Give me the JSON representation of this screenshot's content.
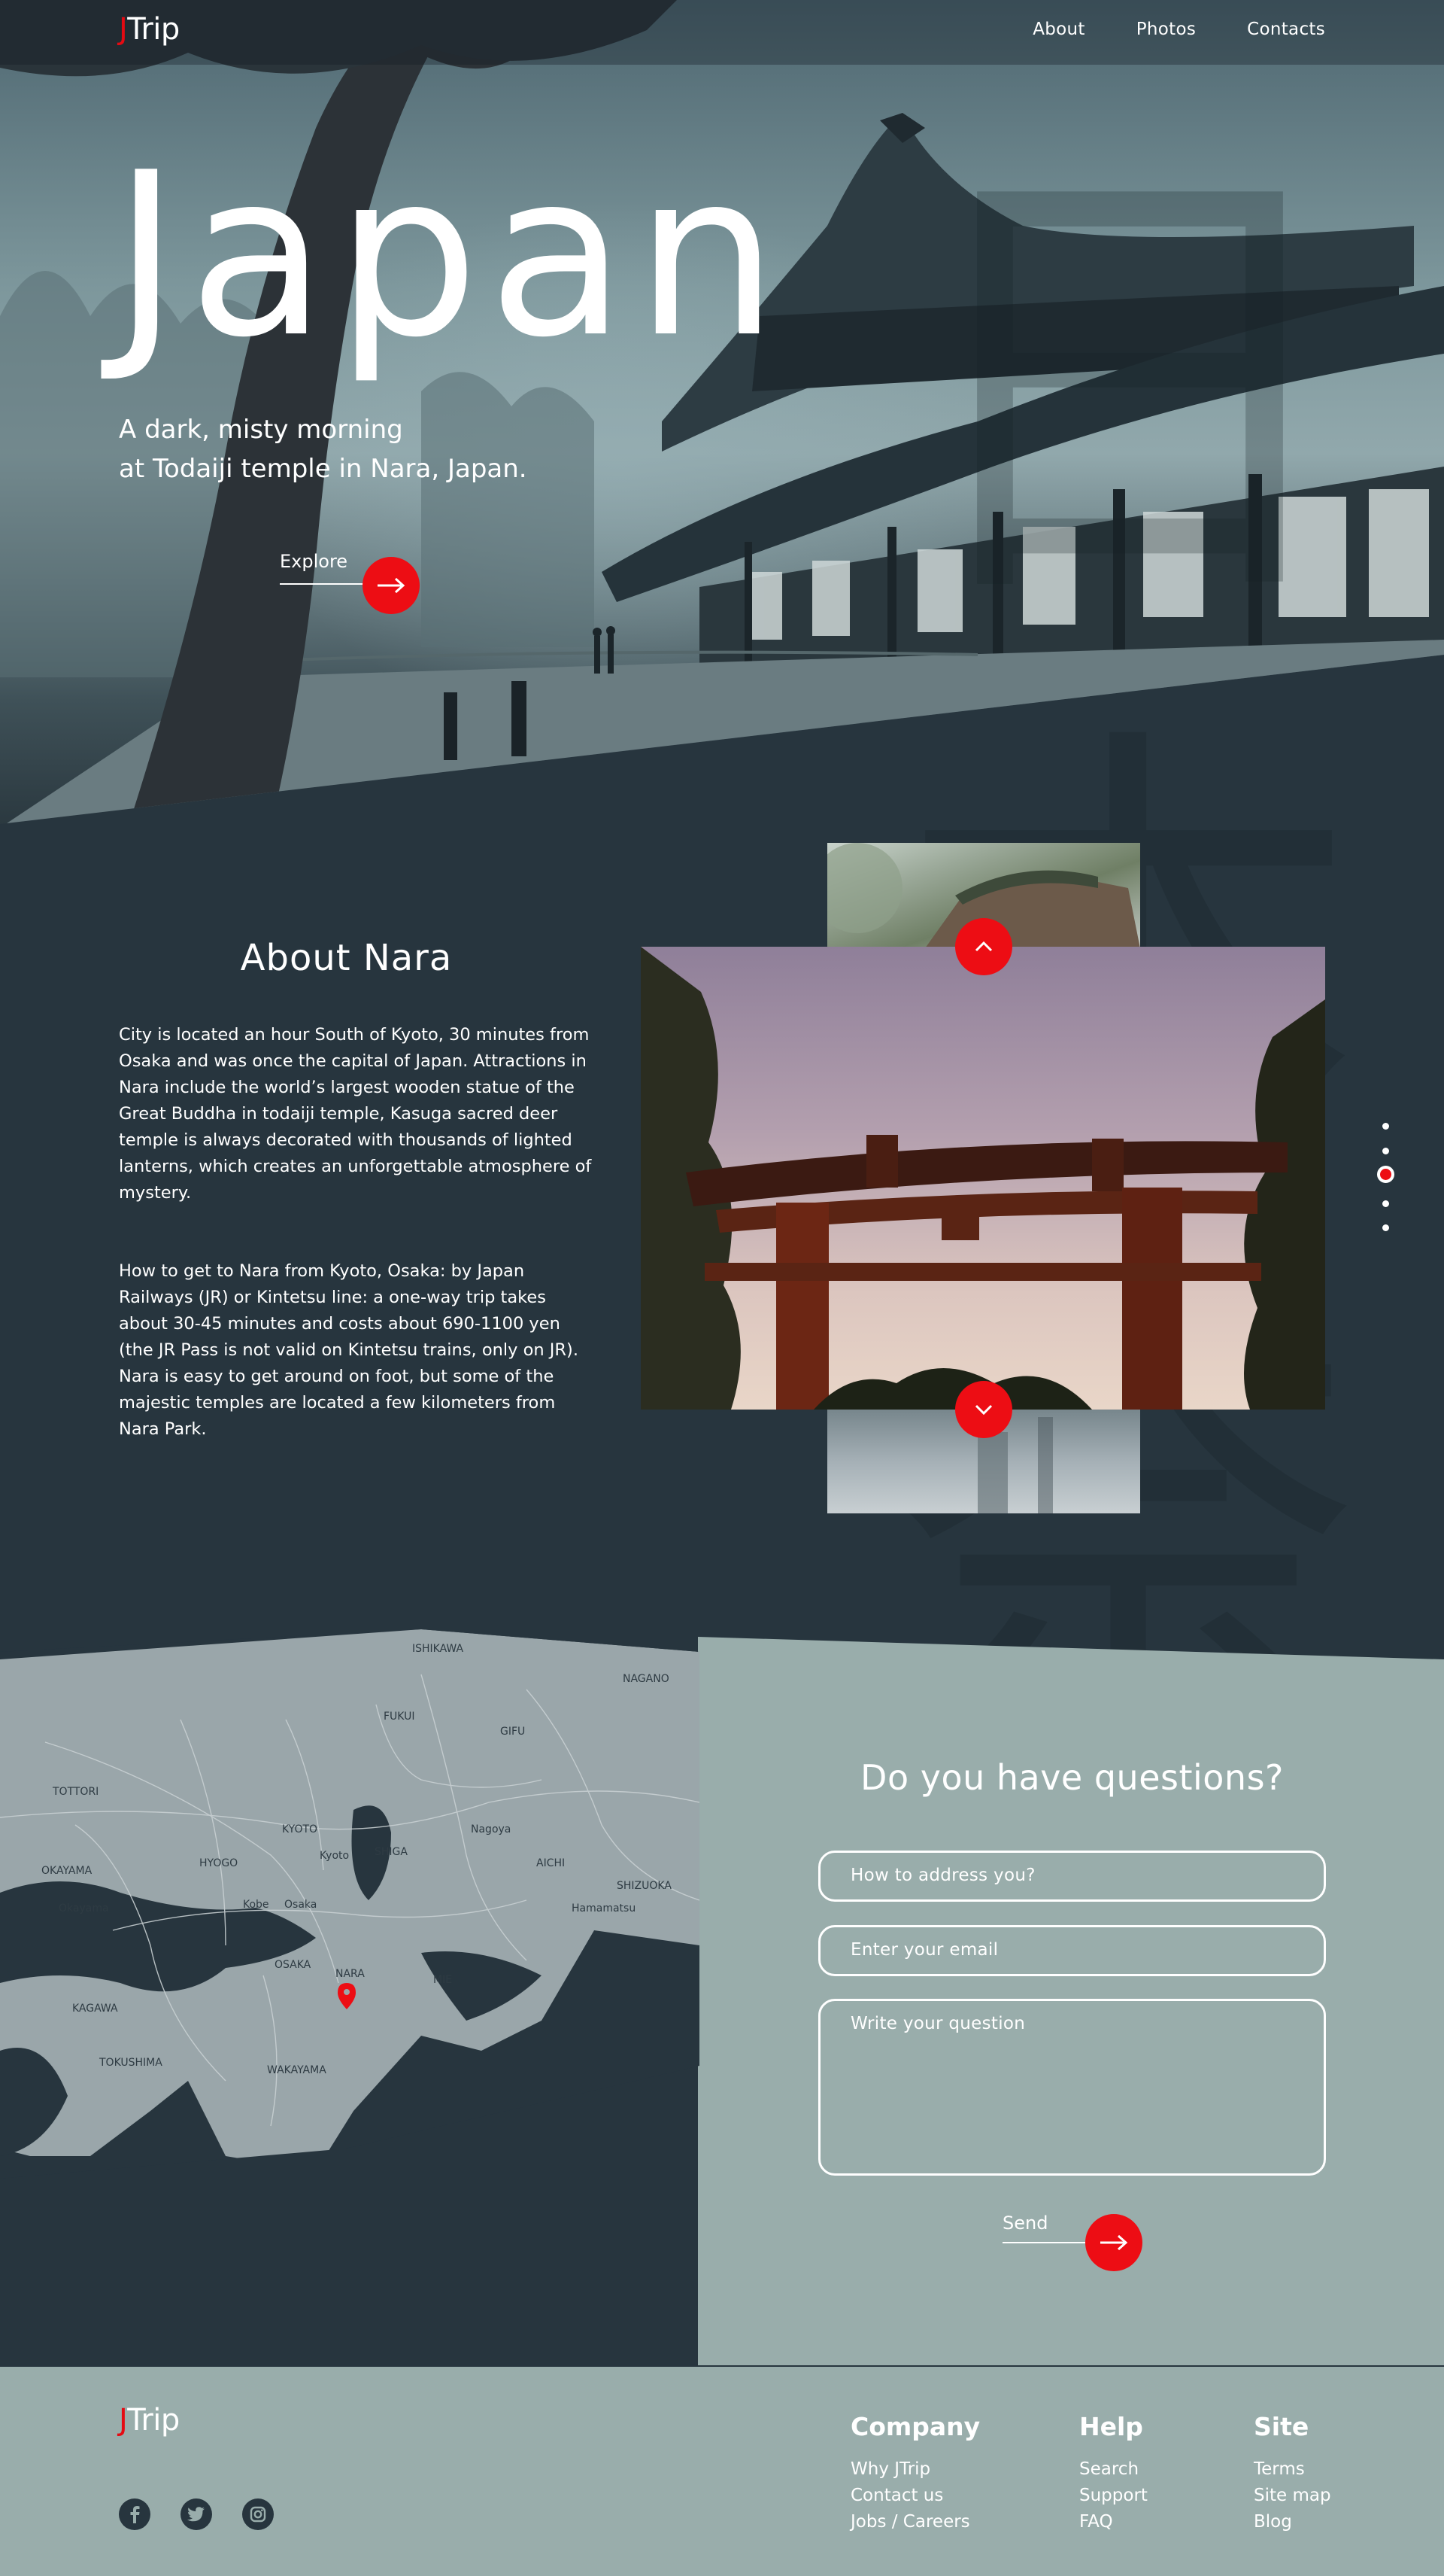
{
  "brand": {
    "mark": "J",
    "name": "Trip"
  },
  "nav": [
    {
      "label": "About"
    },
    {
      "label": "Photos"
    },
    {
      "label": "Contacts"
    }
  ],
  "hero": {
    "title": "Japan",
    "subtitle_line1": "A dark, misty morning",
    "subtitle_line2": "at Todaiji temple in Nara, Japan.",
    "cta_label": "Explore",
    "kanji": "日本奈良"
  },
  "about": {
    "title": "About Nara",
    "paragraph1": "City is located an hour South of Kyoto, 30 minutes from Osaka and was once the capital of Japan. Attractions in Nara include the world’s largest wooden statue of the Great Buddha in todaiji temple, Kasuga sacred deer temple is always decorated with thousands of lighted lanterns, which creates an unforgettable atmosphere of mystery.",
    "paragraph2": "How to get to Nara from Kyoto, Osaka: by Japan Railways (JR) or Kintetsu line: a one-way trip takes about 30-45 minutes and costs about 690-1100 yen (the JR Pass is not valid on Kintetsu trains, only on JR). Nara is easy to get around on foot, but some of the majestic temples are located a few kilometers from Nara Park."
  },
  "slider": {
    "count": 5,
    "active": 3
  },
  "map": {
    "labels": [
      "ISHIKAWA",
      "NAGANO",
      "FUKUI",
      "GIFU",
      "TOTTORI",
      "KYOTO",
      "OKAYAMA",
      "HYOGO",
      "Kyoto",
      "SHIGA",
      "Nagoya",
      "AICHI",
      "SHIZUOKA",
      "Okayama",
      "Kobe",
      "Osaka",
      "OSAKA",
      "NARA",
      "MIE",
      "KAGAWA",
      "TOKUSHIMA",
      "WAKAYAMA",
      "Hamamatsu"
    ]
  },
  "contact": {
    "title": "Do you have questions?",
    "name_placeholder": "How to address you?",
    "email_placeholder": "Enter your email",
    "question_placeholder": "Write your question",
    "send_label": "Send"
  },
  "footer": {
    "columns": [
      {
        "title": "Company",
        "links": [
          "Why JTrip",
          "Contact us",
          "Jobs / Careers"
        ]
      },
      {
        "title": "Help",
        "links": [
          "Search",
          "Support",
          "FAQ"
        ]
      },
      {
        "title": "Site",
        "links": [
          "Terms",
          "Site map",
          "Blog"
        ]
      }
    ],
    "social": [
      "facebook-icon",
      "twitter-icon",
      "instagram-icon"
    ]
  },
  "colors": {
    "accent": "#ed0d14",
    "dark": "#27353e",
    "sage": "#99adab"
  }
}
